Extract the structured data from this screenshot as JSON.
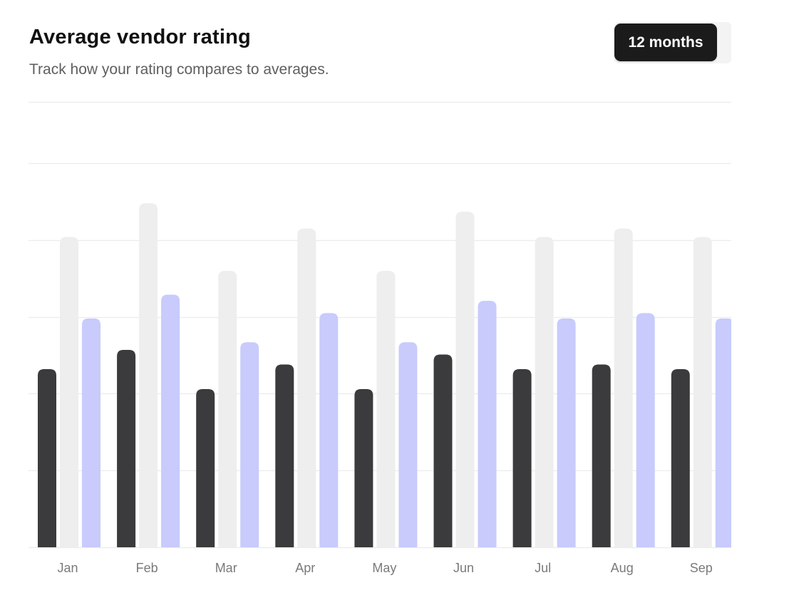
{
  "header": {
    "title": "Average vendor rating",
    "subtitle": "Track how your rating compares to averages."
  },
  "range_selector": {
    "label": "12 months"
  },
  "colors": {
    "your_rating": "#3b3b3d",
    "benchmark_high": "#eeeeee",
    "average": "#c8cbfb",
    "gridline": "#ececec",
    "label": "#7a7a7a"
  },
  "chart_data": {
    "type": "bar",
    "title": "Average vendor rating",
    "categories": [
      "Jan",
      "Feb",
      "Mar",
      "Apr",
      "May",
      "Jun",
      "Jul",
      "Aug",
      "Sep"
    ],
    "series": [
      {
        "values": [
          2.32,
          2.57,
          2.06,
          2.38,
          2.06,
          2.51,
          2.32,
          2.38,
          2.32
        ]
      },
      {
        "values": [
          4.04,
          4.48,
          3.6,
          4.15,
          3.6,
          4.37,
          4.04,
          4.15,
          4.04
        ]
      },
      {
        "values": [
          2.98,
          3.29,
          2.67,
          3.05,
          2.67,
          3.21,
          2.98,
          3.05,
          2.98
        ]
      }
    ],
    "ylim": [
      0,
      5.8
    ],
    "yticks": [
      0,
      1,
      2,
      3,
      4,
      5,
      5.8
    ],
    "grid": true,
    "legend": "none"
  }
}
